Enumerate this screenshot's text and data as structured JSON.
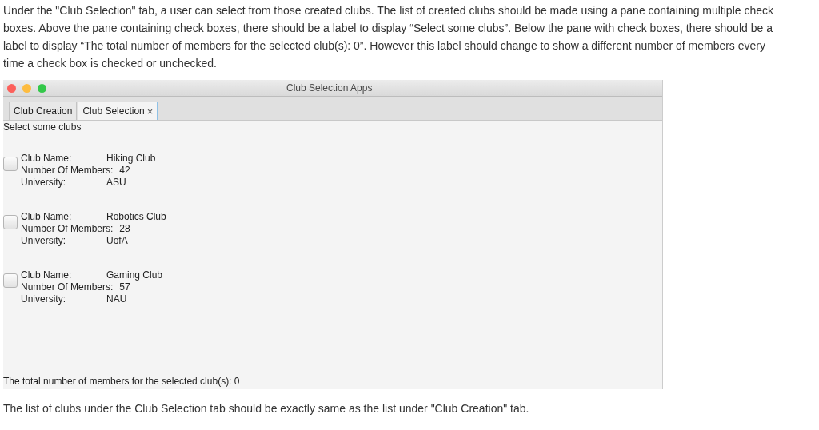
{
  "intro": "Under the \"Club Selection\" tab, a user can select from those created clubs. The list of created clubs should be made using a pane containing multiple check boxes. Above the pane containing check boxes, there should be a label to display “Select some clubs”. Below the pane with check boxes, there should be a label to display “The total number of members for the selected club(s): 0”. However this label should change to show a different number of members every time a check box is checked or unchecked.",
  "window": {
    "title": "Club Selection Apps"
  },
  "tabs": [
    {
      "label": "Club Creation",
      "selected": false
    },
    {
      "label": "Club Selection",
      "selected": true,
      "close_glyph": "×"
    }
  ],
  "header_label": "Select some clubs",
  "clubs": [
    {
      "checked": false,
      "fields": [
        {
          "label": "Club Name:",
          "value": "Hiking Club"
        },
        {
          "label": "Number Of Members:",
          "value": "42"
        },
        {
          "label": "University:",
          "value": "ASU"
        }
      ]
    },
    {
      "checked": false,
      "fields": [
        {
          "label": "Club Name:",
          "value": "Robotics Club"
        },
        {
          "label": "Number Of Members:",
          "value": "28"
        },
        {
          "label": "University:",
          "value": "UofA"
        }
      ]
    },
    {
      "checked": false,
      "fields": [
        {
          "label": "Club Name:",
          "value": "Gaming Club"
        },
        {
          "label": "Number Of Members:",
          "value": "57"
        },
        {
          "label": "University:",
          "value": "NAU"
        }
      ]
    }
  ],
  "total_label": "The total number of members for the selected club(s): 0",
  "outro": "The list of clubs under the Club Selection tab should be exactly same as the list under \"Club Creation\" tab."
}
